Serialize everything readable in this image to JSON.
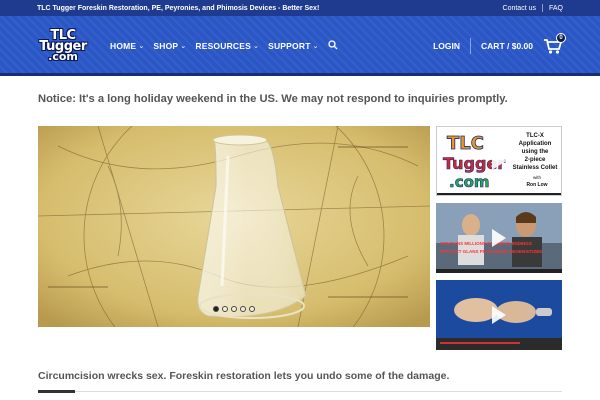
{
  "topbar": {
    "title": "TLC Tugger Foreskin Restoration, PE, Peyronies, and Phimosis Devices - Better Sex!",
    "links": [
      "Contact us",
      "FAQ"
    ]
  },
  "logo": {
    "line1": "TLC",
    "line2": "Tugger",
    "line3": ".com"
  },
  "nav": {
    "items": [
      "HOME",
      "SHOP",
      "RESOURCES",
      "SUPPORT"
    ],
    "search_icon": "search-icon"
  },
  "header_right": {
    "login": "LOGIN",
    "cart": "CART / $0.00",
    "cart_count": "0"
  },
  "notice": "Notice: It's a long holiday weekend in the US. We may not respond to inquiries promptly.",
  "slider": {
    "dots": 5,
    "active": 0
  },
  "thumbs": [
    {
      "logo_line1": "TLC",
      "logo_line2": "Tugger",
      "logo_line3": ".com",
      "text": [
        "TLC-X",
        "Application",
        "using the",
        "2-piece",
        "Stainless Collet"
      ],
      "with": "with",
      "author": "Ron Low"
    },
    {
      "caption1": "CONTAINS MILLIONS OF NERVE ENDINGS",
      "caption2": "PROTECT GLANS FROM BEING DESENSITIZED"
    },
    {}
  ],
  "tagline": "Circumcision wrecks sex. Foreskin restoration lets you undo some of the damage.",
  "colors": {
    "topbar": "#1f3b8f",
    "header": "#2a56c6",
    "text": "#555555"
  }
}
